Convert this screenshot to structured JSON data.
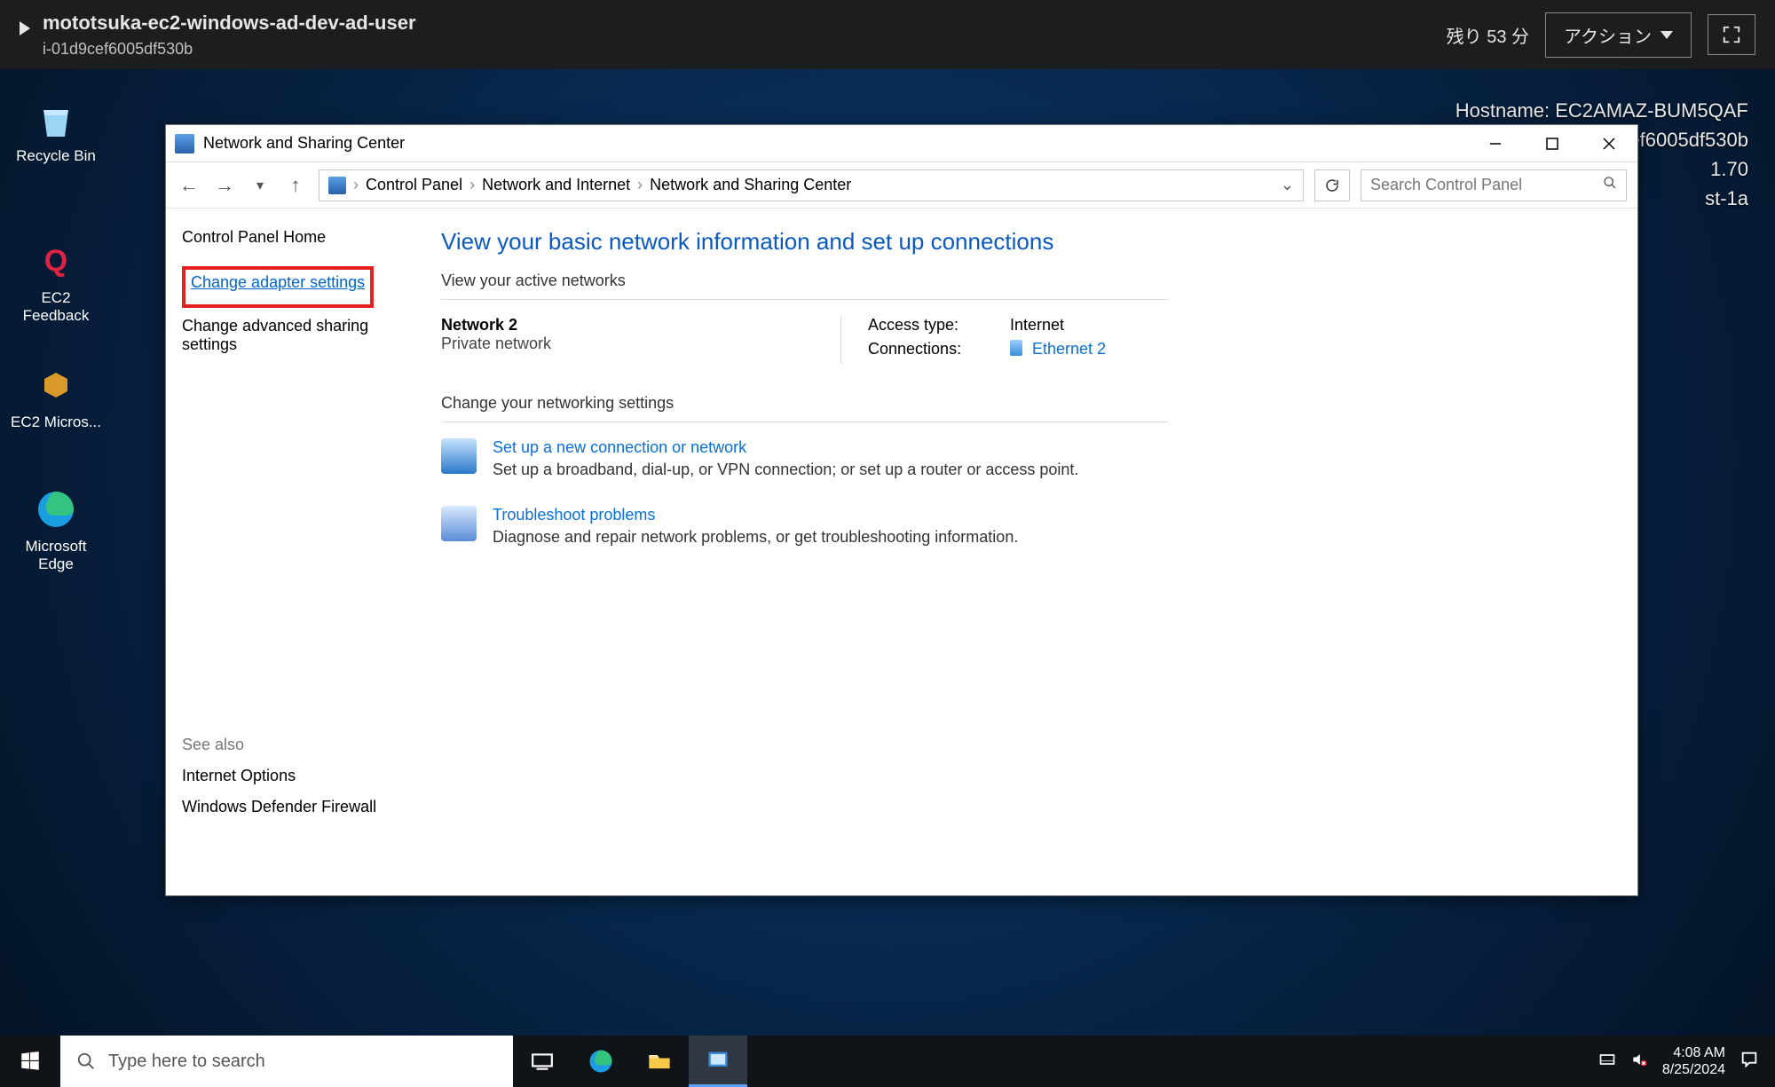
{
  "session": {
    "title": "mototsuka-ec2-windows-ad-dev-ad-user",
    "instance_id": "i-01d9cef6005df530b",
    "timer": "残り 53 分",
    "action_label": "アクション"
  },
  "host_info": {
    "hostname_label": "Hostname: EC2AMAZ-BUM5QAF",
    "instance_line": "Instance ID: i-01d9cef6005df530b",
    "extra_line1": "1.70",
    "extra_line2": "st-1a"
  },
  "desktop_icons": {
    "recycle": "Recycle Bin",
    "ec2fb": "EC2 Feedback",
    "ec2ms": "EC2 Micros...",
    "edge": "Microsoft Edge"
  },
  "window": {
    "title": "Network and Sharing Center",
    "breadcrumbs": [
      "Control Panel",
      "Network and Internet",
      "Network and Sharing Center"
    ],
    "search_placeholder": "Search Control Panel",
    "sidebar": {
      "home": "Control Panel Home",
      "change_adapter": "Change adapter settings",
      "change_advanced": "Change advanced sharing settings",
      "see_also_header": "See also",
      "see_also": [
        "Internet Options",
        "Windows Defender Firewall"
      ]
    },
    "main": {
      "heading": "View your basic network information and set up connections",
      "active_label": "View your active networks",
      "network_name": "Network 2",
      "network_type": "Private network",
      "access_type_label": "Access type:",
      "access_type_value": "Internet",
      "connections_label": "Connections:",
      "connection_link": "Ethernet 2",
      "change_settings_label": "Change your networking settings",
      "opt1_title": "Set up a new connection or network",
      "opt1_desc": "Set up a broadband, dial-up, or VPN connection; or set up a router or access point.",
      "opt2_title": "Troubleshoot problems",
      "opt2_desc": "Diagnose and repair network problems, or get troubleshooting information."
    }
  },
  "taskbar": {
    "search_placeholder": "Type here to search",
    "time": "4:08 AM",
    "date": "8/25/2024"
  }
}
